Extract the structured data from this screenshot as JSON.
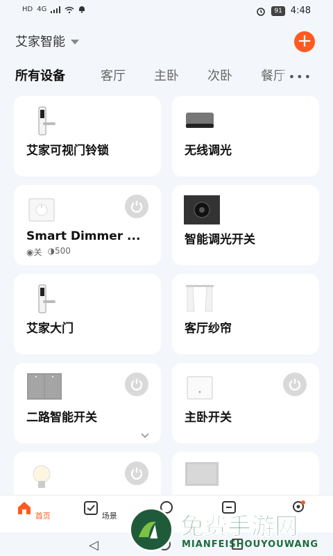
{
  "status": {
    "left_icons": [
      "HD",
      "4G",
      "signal-icon",
      "wifi-icon",
      "bell-icon"
    ],
    "battery": "91",
    "time": "4:48"
  },
  "home": {
    "title": "艾家智能",
    "add_label": "+"
  },
  "tabs": [
    "所有设备",
    "客厅",
    "主卧",
    "次卧",
    "餐厅"
  ],
  "tabs_more": "•••",
  "devices": [
    {
      "name": "艾家可视门铃锁",
      "icon": "door-lock-icon",
      "power": false
    },
    {
      "name": "无线调光",
      "icon": "dimmer-knob-icon",
      "power": false
    },
    {
      "name": "Smart Dimmer ...",
      "icon": "smart-dimmer-icon",
      "power": true,
      "status_off": "关",
      "status_level": "500"
    },
    {
      "name": "智能调光开关",
      "icon": "dimmer-switch-icon",
      "power": false
    },
    {
      "name": "艾家大门",
      "icon": "door-lock-icon",
      "power": false
    },
    {
      "name": "客厅纱帘",
      "icon": "curtain-icon",
      "power": false
    },
    {
      "name": "二路智能开关",
      "icon": "two-gang-switch-icon",
      "power": true
    },
    {
      "name": "主卧开关",
      "icon": "wall-switch-icon",
      "power": true
    },
    {
      "name": "",
      "icon": "bulb-icon",
      "power": true
    },
    {
      "name": "",
      "icon": "panel-icon",
      "power": false
    }
  ],
  "tabbar": [
    {
      "label": "首页",
      "icon": "home-icon"
    },
    {
      "label": "场景",
      "icon": "scene-icon"
    },
    {
      "label": "",
      "icon": "chat-icon"
    },
    {
      "label": "",
      "icon": "message-icon"
    },
    {
      "label": "",
      "icon": "profile-icon"
    }
  ],
  "watermark": {
    "text": "免费手游网",
    "sub": "MIANFEISHOUYOUWANG"
  },
  "colors": {
    "accent": "#ff5a1f",
    "background": "#f3f6fa",
    "card": "#ffffff"
  }
}
